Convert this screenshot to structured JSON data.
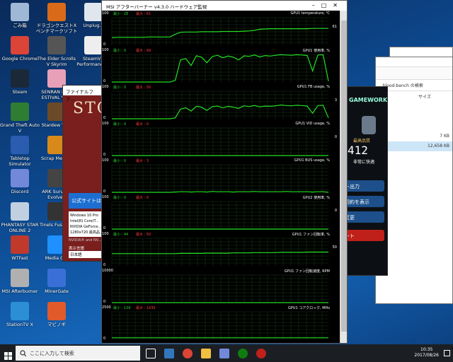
{
  "desktop_icons": [
    {
      "label": "ごみ箱",
      "icon": "recycle-bin-icon",
      "color": "#9fb8d6"
    },
    {
      "label": "ドラゴンクエストX ベンチマークソフト",
      "icon": "dragon-quest-icon",
      "color": "#d86a1a"
    },
    {
      "label": "Unplug...",
      "icon": "unplug-icon",
      "color": "#dfe6ee"
    },
    {
      "label": "Google Chrome",
      "icon": "chrome-icon",
      "color": "#db4437"
    },
    {
      "label": "The Elder Scrolls V Skyrim",
      "icon": "skyrim-icon",
      "color": "#555555"
    },
    {
      "label": "SteamVR Performance...",
      "icon": "steamvr-icon",
      "color": "#eeeeee"
    },
    {
      "label": "Steam",
      "icon": "steam-icon",
      "color": "#1b2838"
    },
    {
      "label": "SENRAN KA... ESTIVAL VE...",
      "icon": "senran-icon",
      "color": "#e8a0b8"
    },
    {
      "label": "Grand Theft Auto V",
      "icon": "gta-icon",
      "color": "#2f7d32"
    },
    {
      "label": "Stardew Va...",
      "icon": "stardew-icon",
      "color": "#6b4a2a"
    },
    {
      "label": "Tabletop Simulator",
      "icon": "tabletop-icon",
      "color": "#2a5db0"
    },
    {
      "label": "Scrap Mech...",
      "icon": "scrap-icon",
      "color": "#d78a1a"
    },
    {
      "label": "Discord",
      "icon": "discord-icon",
      "color": "#7289da"
    },
    {
      "label": "ARK Surviv... Evolved",
      "icon": "ark-icon",
      "color": "#444444"
    },
    {
      "label": "PHANTASY STAR ONLINE 2",
      "icon": "pso2-icon",
      "color": "#c0d0e0"
    },
    {
      "label": "Tinels Fusion...",
      "icon": "tinels-icon",
      "color": "#333333"
    },
    {
      "label": "WTFast",
      "icon": "wtfast-icon",
      "color": "#c0392b"
    },
    {
      "label": "Media G...",
      "icon": "media-icon",
      "color": "#1e90ff"
    },
    {
      "label": "MSI Afterburner",
      "icon": "afterburner-icon",
      "color": "#b0b0b0"
    },
    {
      "label": "MinerGate",
      "icon": "minergate-icon",
      "color": "#3b6fd8"
    },
    {
      "label": "StationTV X",
      "icon": "stationtv-icon",
      "color": "#2c8fd6"
    },
    {
      "label": "マビノギ",
      "icon": "mabinogi-icon",
      "color": "#e05a2a"
    }
  ],
  "background_window": {
    "title": "ファイナルファ...",
    "logo_text": "STO",
    "official_site_button": "公式サイトは",
    "specs": [
      "Windows 10 Pro",
      "Intel(R) Core(T...",
      "NVIDIA GeForce...",
      "1280x720 最高品..."
    ],
    "footer": "NVIDIA® and NV...",
    "lang_label": "表示言語",
    "lang_value": "日本語"
  },
  "gameworks_window": {
    "brand": "GAMEWORKS",
    "rating_label": "最高品質",
    "score": "412",
    "comfort": "非常に快適",
    "buttons": [
      "ト出力",
      "契約を表示",
      "変更",
      "ート"
    ]
  },
  "explorer_window": {
    "path": "...blood-bench の検索",
    "col_size": "サイズ",
    "items": [
      {
        "name": "ダー",
        "size": ""
      },
      {
        "name": "ダー",
        "size": ""
      },
      {
        "name": "ダー",
        "size": ""
      },
      {
        "name": "",
        "size": "7 KB"
      },
      {
        "name": "",
        "size": "12,658 KB"
      }
    ]
  },
  "msi_window": {
    "title": "MSI アフターバーナー v4.3.0 ハードウェア監視",
    "graphs": [
      {
        "name": "GPU1 temperature, ℃",
        "top": "100",
        "bottom": "0",
        "min_label": "最小 : 28",
        "max_label": "最大 : 61",
        "current": "61",
        "color": "#22e022",
        "values": [
          28,
          29,
          29,
          29,
          29,
          29,
          29,
          30,
          30,
          30,
          30,
          30,
          40,
          47,
          48,
          48,
          48,
          49,
          49,
          49,
          49,
          50,
          50,
          50,
          50,
          51,
          52,
          54,
          58,
          59,
          60,
          60,
          60,
          60,
          60,
          60,
          60,
          60,
          61,
          61,
          61,
          61
        ]
      },
      {
        "name": "GPU1 使用率, %",
        "top": "100",
        "bottom": "0",
        "min_label": "最小 : 0",
        "max_label": "最大 : 99",
        "current": "",
        "color": "#22e022",
        "values": [
          0,
          0,
          0,
          0,
          0,
          0,
          0,
          0,
          0,
          0,
          0,
          0,
          6,
          80,
          85,
          60,
          95,
          90,
          70,
          92,
          97,
          88,
          94,
          90,
          80,
          95,
          93,
          98,
          91,
          96,
          94,
          97,
          99,
          98,
          97,
          99,
          98,
          96,
          40,
          98,
          99,
          3
        ]
      },
      {
        "name": "GPU1 FB usage, %",
        "top": "100",
        "bottom": "0",
        "min_label": "最小 : 0",
        "max_label": "最大 : 50",
        "current": "3",
        "color": "#22e022",
        "values": [
          0,
          0,
          0,
          0,
          0,
          0,
          0,
          0,
          0,
          0,
          0,
          0,
          3,
          35,
          40,
          28,
          45,
          42,
          30,
          44,
          46,
          40,
          45,
          42,
          38,
          47,
          44,
          48,
          43,
          46,
          45,
          47,
          50,
          48,
          47,
          49,
          48,
          46,
          20,
          48,
          49,
          3
        ]
      },
      {
        "name": "GPU1 VID usage, %",
        "top": "100",
        "bottom": "0",
        "min_label": "最小 : 0",
        "max_label": "最大 : 0",
        "current": "0",
        "color": "#22e022",
        "values": [
          0,
          0,
          0,
          0,
          0,
          0,
          0,
          0,
          0,
          0,
          0,
          0,
          0,
          0,
          0,
          0,
          0,
          0,
          0,
          0,
          0,
          0,
          0,
          0,
          0,
          0,
          0,
          0,
          0,
          0,
          0,
          0,
          0,
          0,
          0,
          0,
          0,
          0,
          0,
          0,
          0,
          0
        ]
      },
      {
        "name": "GPU1 BUS usage, %",
        "top": "100",
        "bottom": "0",
        "min_label": "最小 : 0",
        "max_label": "最大 : 3",
        "current": "",
        "color": "#22e022",
        "values": [
          0,
          0,
          0,
          0,
          0,
          0,
          0,
          0,
          0,
          0,
          0,
          0,
          1,
          2,
          2,
          1,
          2,
          2,
          1,
          3,
          2,
          2,
          2,
          1,
          2,
          2,
          2,
          3,
          2,
          2,
          2,
          2,
          2,
          3,
          2,
          2,
          2,
          2,
          1,
          2,
          2,
          0
        ]
      },
      {
        "name": "GPU2 使用率, %",
        "top": "100",
        "bottom": "0",
        "min_label": "最小 : 0",
        "max_label": "最大 : 0",
        "current": "0",
        "color": "#22e022",
        "values": [
          0,
          0,
          0,
          0,
          0,
          0,
          0,
          0,
          0,
          0,
          0,
          0,
          0,
          0,
          0,
          0,
          0,
          0,
          0,
          0,
          0,
          0,
          0,
          0,
          0,
          0,
          0,
          0,
          0,
          0,
          0,
          0,
          0,
          0,
          0,
          0,
          0,
          0,
          0,
          0,
          0,
          0
        ]
      },
      {
        "name": "GPU1 ファン回転率, %",
        "top": "100",
        "bottom": "0",
        "min_label": "最小 : 44",
        "max_label": "最大 : 50",
        "current": "50",
        "color": "#22e022",
        "values": [
          44,
          44,
          44,
          44,
          44,
          44,
          44,
          44,
          44,
          44,
          44,
          44,
          44,
          45,
          45,
          45,
          45,
          45,
          46,
          46,
          46,
          46,
          46,
          47,
          47,
          47,
          47,
          48,
          48,
          48,
          48,
          48,
          49,
          49,
          49,
          49,
          49,
          50,
          50,
          50,
          50,
          50
        ]
      },
      {
        "name": "GPU1 ファン回転速度, RPM",
        "top": "10000",
        "bottom": "0",
        "min_label": "",
        "max_label": "",
        "current": "",
        "color": "#22e022",
        "values": [
          0,
          0,
          0,
          0,
          0,
          0,
          0,
          0,
          0,
          0,
          0,
          0,
          0,
          0,
          0,
          0,
          0,
          0,
          0,
          0,
          0,
          0,
          0,
          0,
          0,
          0,
          0,
          0,
          0,
          0,
          0,
          0,
          0,
          0,
          0,
          0,
          0,
          0,
          0,
          0,
          0,
          0
        ]
      },
      {
        "name": "GPU1 コアクロック, MHz",
        "top": "2500",
        "bottom": "0",
        "min_label": "最小 : 139",
        "max_label": "最大 : 1430",
        "current": "",
        "color": "#22e022",
        "values": [
          139,
          139,
          139,
          139,
          139,
          139,
          139,
          139,
          139,
          139,
          139,
          139,
          139,
          139,
          139,
          139,
          139,
          139,
          139,
          139,
          139,
          139,
          139,
          139,
          139,
          139,
          139,
          139,
          139,
          139,
          139,
          139,
          139,
          139,
          139,
          139,
          139,
          139,
          139,
          139,
          139,
          139
        ]
      }
    ]
  },
  "taskbar": {
    "search_placeholder": "ここに入力して検索",
    "time": "10:35",
    "date": "2017/08/26",
    "apps": [
      "task-view-icon",
      "edge-icon",
      "chrome-icon",
      "file-explorer-icon",
      "discord-icon",
      "xbox-icon",
      "afterburner-icon"
    ]
  }
}
